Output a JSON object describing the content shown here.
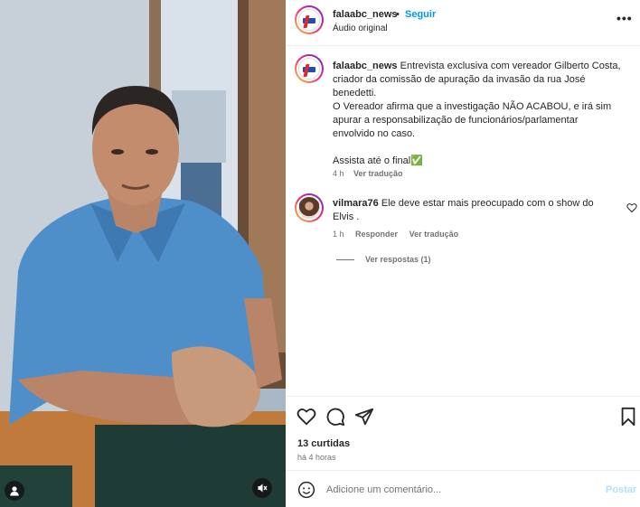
{
  "post": {
    "username": "falaabc_news",
    "separator": "•",
    "follow_label": "Seguir",
    "audio_label": "Áudio original",
    "more_label": "•••"
  },
  "caption": {
    "username": "falaabc_news",
    "text_line1": "Entrevista exclusiva com vereador Gilberto Costa, criador da comissão de apuração da invasão da rua José benedetti.",
    "text_line2": "O Vereador afirma que a investigação NÃO ACABOU, e irá sim apurar a responsabilização de funcionários/parlamentar envolvido no caso.",
    "text_line3": "Assista até o final",
    "check_emoji": "✅",
    "time": "4 h",
    "translate_label": "Ver tradução"
  },
  "comment": {
    "username": "vilmara76",
    "text": "Ele deve estar mais preocupado com o show do Elvis .",
    "time": "1 h",
    "reply_label": "Responder",
    "translate_label": "Ver tradução",
    "view_replies_label": "Ver respostas (1)"
  },
  "actions": {
    "icons": [
      "heart-icon",
      "comment-icon",
      "share-icon",
      "bookmark-icon"
    ],
    "likes_label": "13 curtidas",
    "posted_label": "há 4 horas"
  },
  "add_comment": {
    "placeholder": "Adicione um comentário...",
    "post_label": "Postar"
  },
  "colors": {
    "accent": "#0095f6",
    "post_disabled": "#b2dffc",
    "muted_text": "#737373",
    "shirt": "#4f8fc9"
  }
}
